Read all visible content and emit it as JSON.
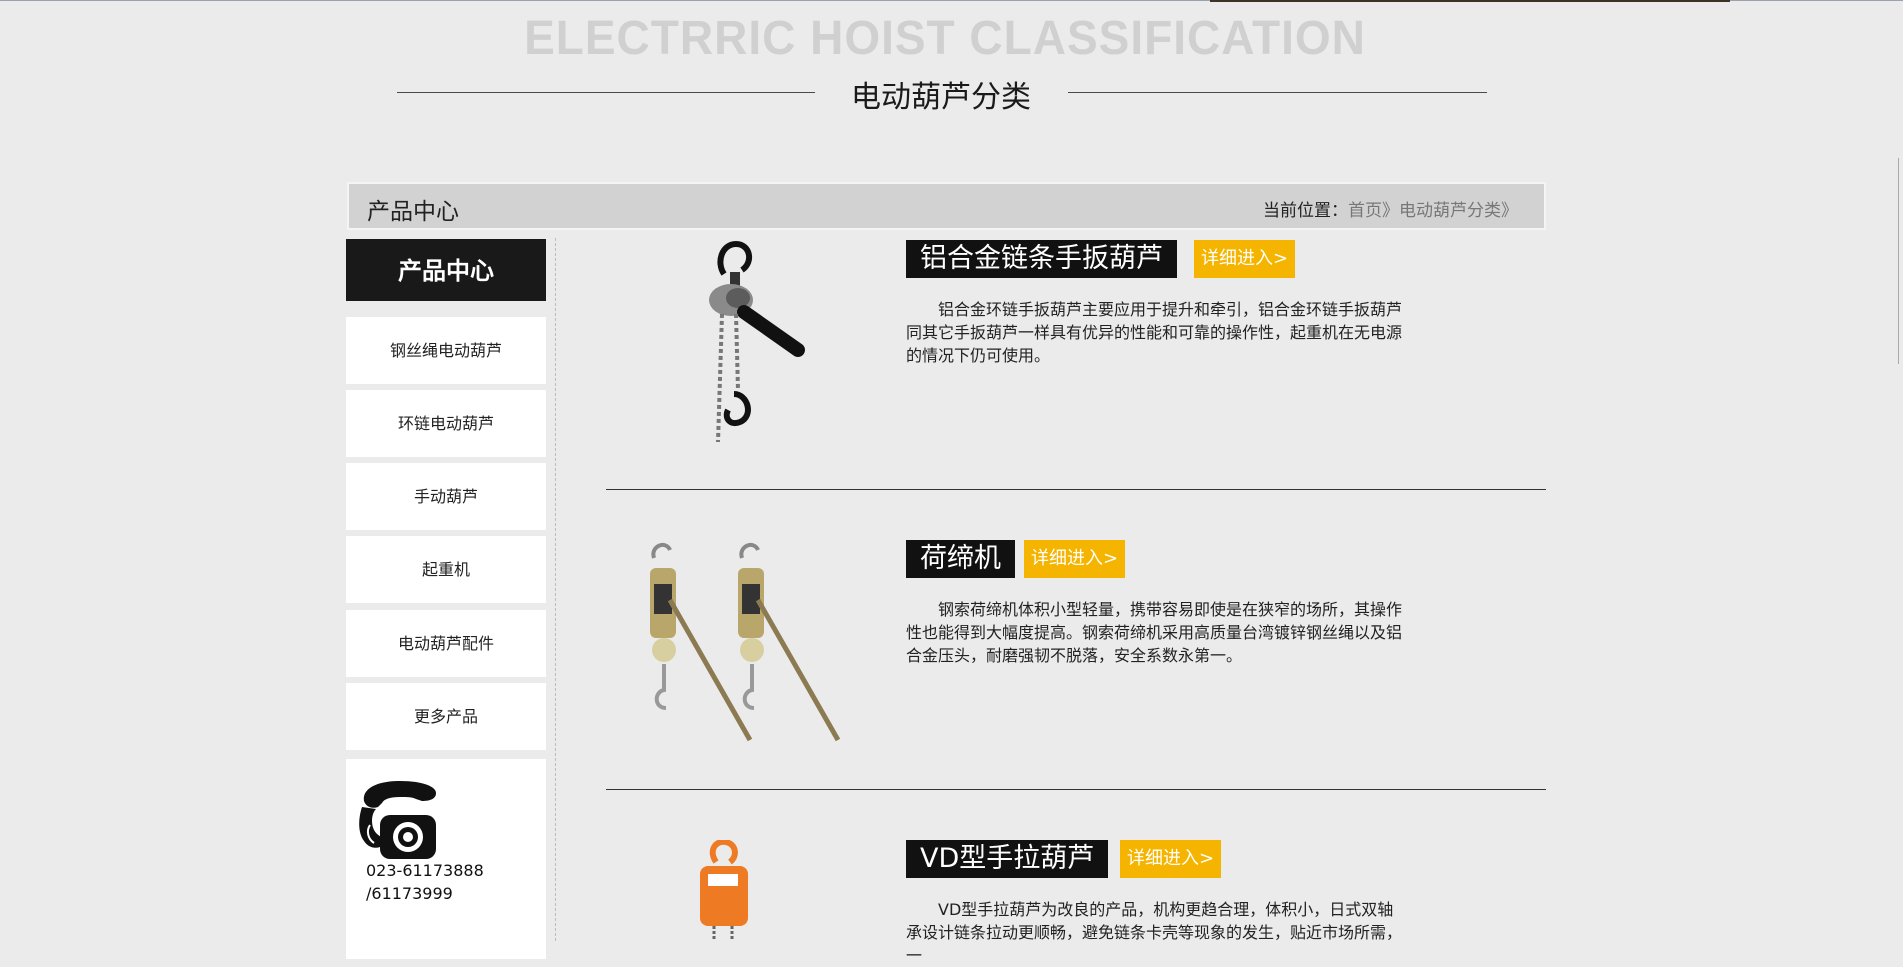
{
  "section": {
    "english_title": "ELECTRRIC HOIST CLASSIFICATION",
    "chinese_title": "电动葫芦分类"
  },
  "bar": {
    "title": "产品中心",
    "crumb_prefix": "当前位置：",
    "crumb_home": "首页",
    "crumb_sep": "》",
    "crumb_current": "电动葫芦分类",
    "crumb_end": "》"
  },
  "sidebar": {
    "heading": "产品中心",
    "items": [
      {
        "label": "钢丝绳电动葫芦"
      },
      {
        "label": "环链电动葫芦"
      },
      {
        "label": "手动葫芦"
      },
      {
        "label": "起重机"
      },
      {
        "label": "电动葫芦配件"
      },
      {
        "label": "更多产品"
      }
    ],
    "contact": {
      "icon": "telephone-icon",
      "phone_line1": "023-61173888",
      "phone_line2": "/61173999"
    }
  },
  "products": [
    {
      "name": "铝合金链条手扳葫芦",
      "more": "详细进入>",
      "description": "铝合金环链手扳葫芦主要应用于提升和牵引，铝合金环链手扳葫芦同其它手扳葫芦一样具有优异的性能和可靠的操作性，起重机在无电源的情况下仍可使用。",
      "image": "lever-hoist-image"
    },
    {
      "name": "荷缔机",
      "more": "详细进入>",
      "description": "钢索荷缔机体积小型轻量，携带容易即使是在狭窄的场所，其操作性也能得到大幅度提高。钢索荷缔机采用高质量台湾镀锌钢丝绳以及铝合金压头，耐磨强韧不脱落，安全系数永第一。",
      "image": "cable-puller-image"
    },
    {
      "name": "VD型手拉葫芦",
      "more": "详细进入>",
      "description": "VD型手拉葫芦为改良的产品，机构更趋合理，体积小，日式双轴承设计链条拉动更顺畅，避免链条卡壳等现象的发生，贴近市场所需，一",
      "image": "chain-block-image"
    }
  ]
}
